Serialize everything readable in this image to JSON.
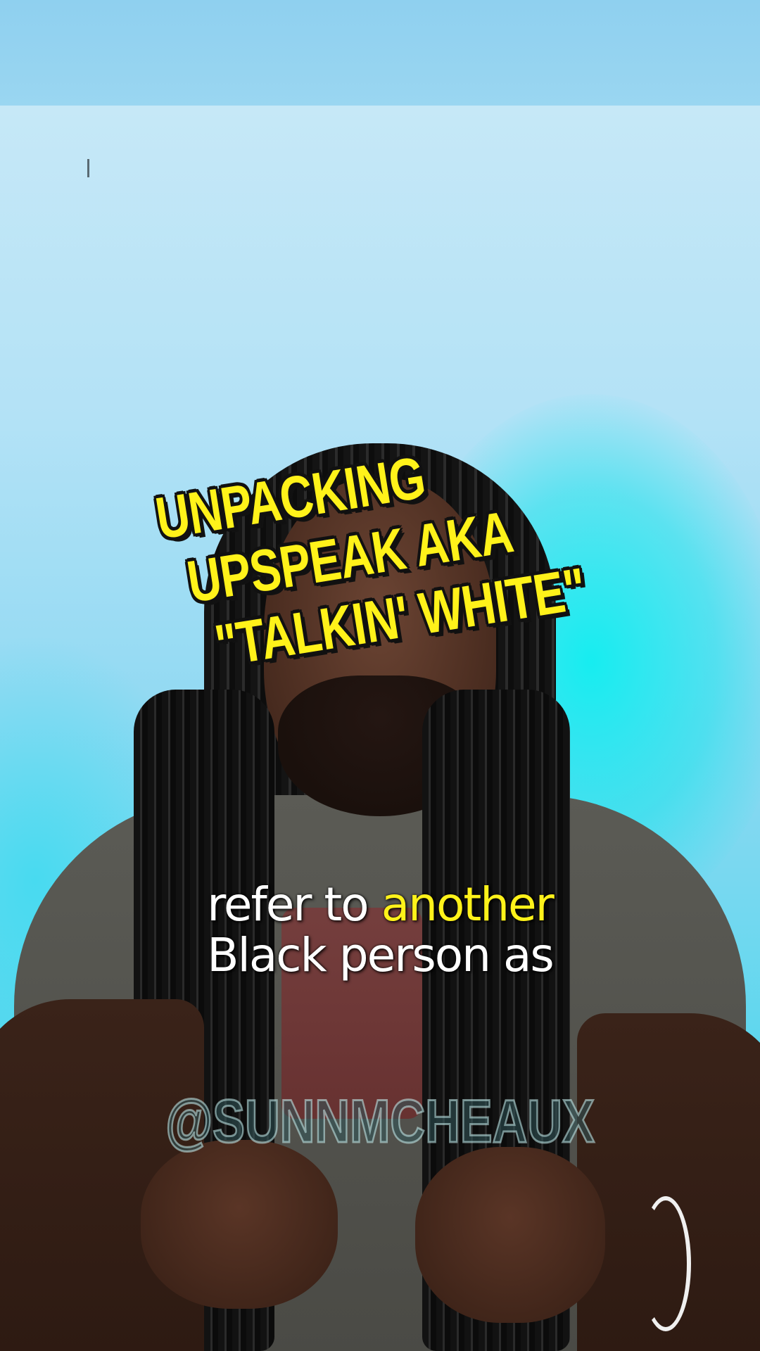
{
  "title_overlay": {
    "lines": [
      "UNPACKING",
      "UPSPEAK AKA",
      "\"TALKIN' WHITE\""
    ],
    "color": "#fff21a",
    "outline": "#111111"
  },
  "caption": {
    "line1_white": "refer to",
    "line1_highlight": "another",
    "line2": "Black person as",
    "color": "#ffffff",
    "highlight_color": "#fff21a"
  },
  "watermark": {
    "text": "@SUNNMCHEAUX"
  },
  "background": {
    "wall_color": "#b3e2f6",
    "glow_color": "#00f0f0"
  }
}
